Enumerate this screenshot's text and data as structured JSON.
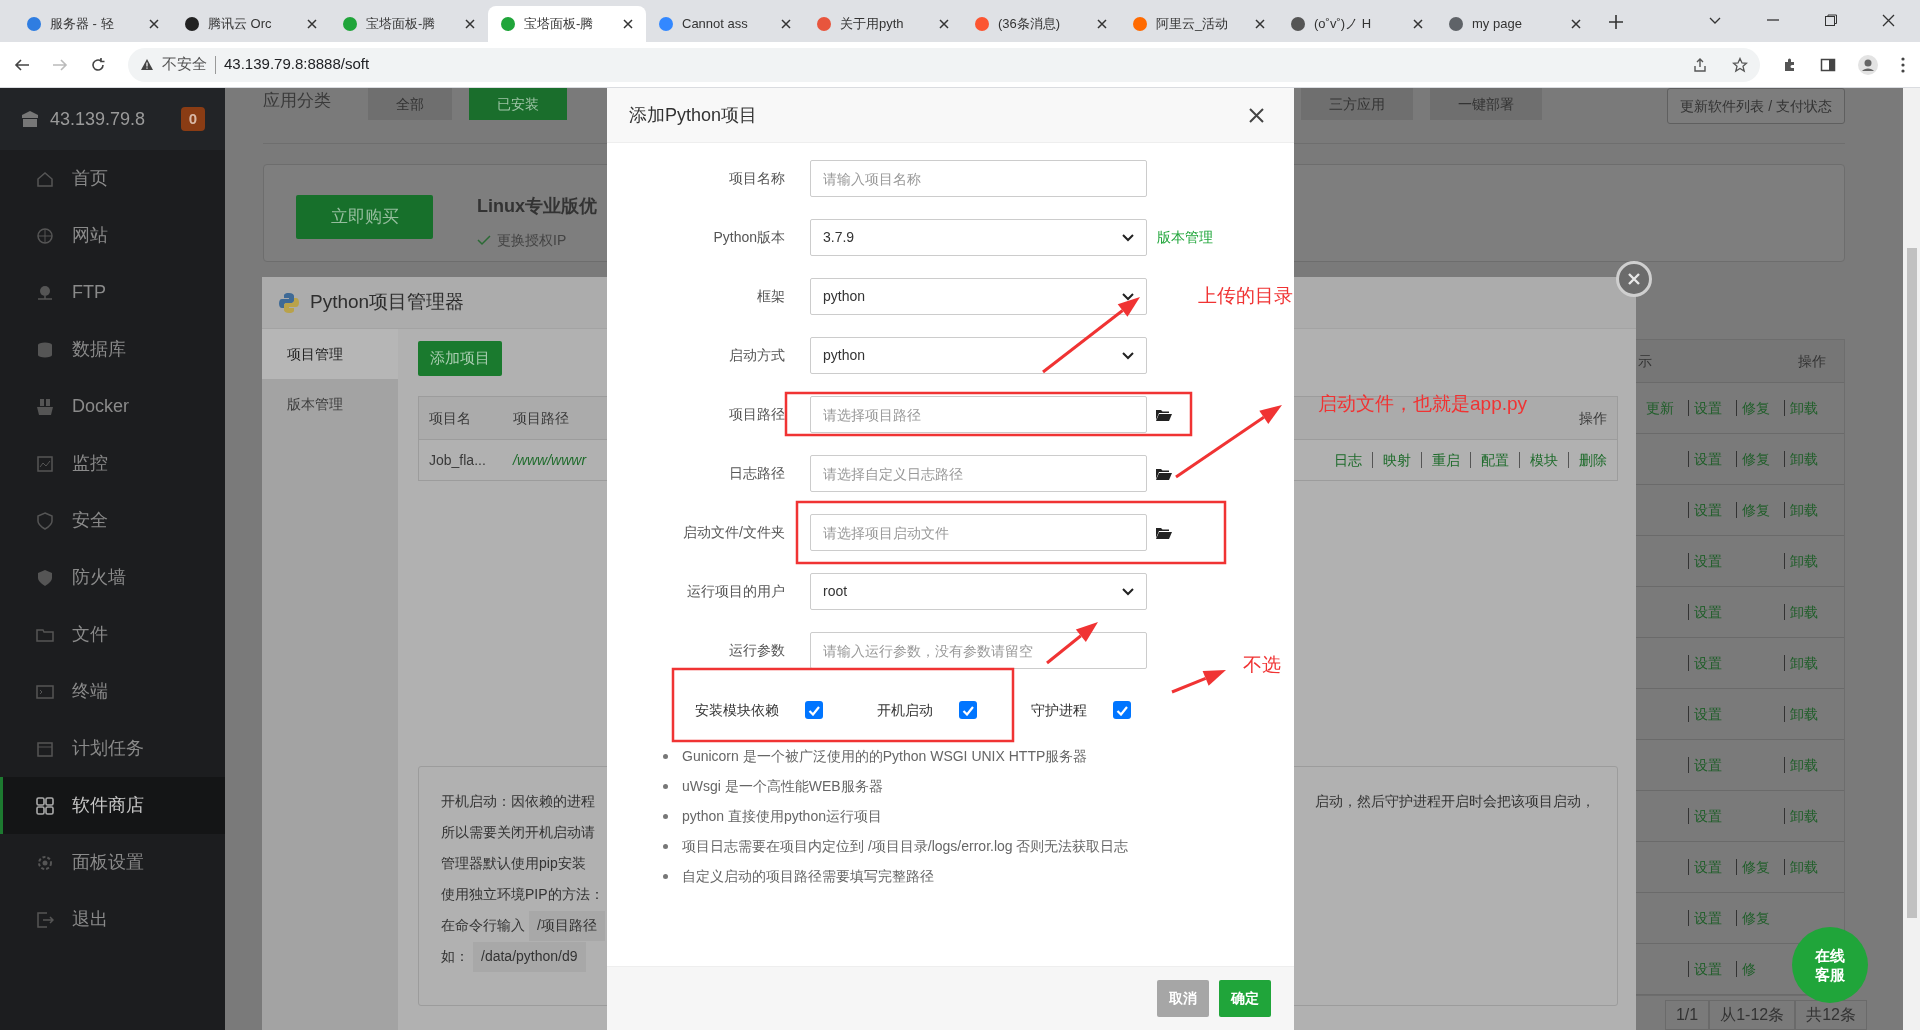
{
  "browser": {
    "tabs": [
      {
        "title": "服务器 - 轻",
        "selected": false,
        "color": "#2f7de1"
      },
      {
        "title": "腾讯云 Orc",
        "selected": false,
        "color": "#222222"
      },
      {
        "title": "宝塔面板-腾",
        "selected": false,
        "color": "#20a53a"
      },
      {
        "title": "宝塔面板-腾",
        "selected": true,
        "color": "#20a53a"
      },
      {
        "title": "Cannot ass",
        "selected": false,
        "color": "#3388ff"
      },
      {
        "title": "关于用pyth",
        "selected": false,
        "color": "#e8553d"
      },
      {
        "title": "(36条消息)",
        "selected": false,
        "color": "#fc5531"
      },
      {
        "title": "阿里云_活动",
        "selected": false,
        "color": "#ff6a00"
      },
      {
        "title": "(o˚v˚)ノ H",
        "selected": false,
        "color": "#555555"
      },
      {
        "title": "my page",
        "selected": false,
        "color": "#5f6368"
      }
    ],
    "address": {
      "security": "不安全",
      "url": "43.139.79.8:8888/soft"
    }
  },
  "sidebar": {
    "host": "43.139.79.8",
    "badge": "0",
    "items": [
      {
        "label": "首页",
        "selected": false
      },
      {
        "label": "网站",
        "selected": false
      },
      {
        "label": "FTP",
        "selected": false
      },
      {
        "label": "数据库",
        "selected": false
      },
      {
        "label": "Docker",
        "selected": false
      },
      {
        "label": "监控",
        "selected": false
      },
      {
        "label": "安全",
        "selected": false
      },
      {
        "label": "防火墙",
        "selected": false
      },
      {
        "label": "文件",
        "selected": false
      },
      {
        "label": "终端",
        "selected": false
      },
      {
        "label": "计划任务",
        "selected": false
      },
      {
        "label": "软件商店",
        "selected": true
      },
      {
        "label": "面板设置",
        "selected": false
      },
      {
        "label": "退出",
        "selected": false
      }
    ]
  },
  "store": {
    "category_label": "应用分类",
    "filters": [
      {
        "label": "全部",
        "selected": false
      },
      {
        "label": "已安装",
        "selected": true
      }
    ],
    "filters_right": [
      {
        "label": "三方应用",
        "selected": false
      },
      {
        "label": "一键部署",
        "selected": false
      }
    ],
    "refresh_button": "更新软件列表 / 支付状态",
    "banner": {
      "buy_button": "立即购买",
      "title": "Linux专业版优",
      "feature": "更换授权IP"
    },
    "table": {
      "column_1": "示",
      "column_2": "操作",
      "rows": [
        {
          "actions": [
            {
              "label": "更新",
              "kind": "update"
            },
            {
              "label": "设置",
              "kind": "settings"
            },
            {
              "label": "修复",
              "kind": "repair"
            },
            {
              "label": "卸载",
              "kind": "uninstall"
            }
          ]
        },
        {
          "actions": [
            {
              "label": "设置",
              "kind": "settings"
            },
            {
              "label": "修复",
              "kind": "repair"
            },
            {
              "label": "卸载",
              "kind": "uninstall"
            }
          ]
        },
        {
          "actions": [
            {
              "label": "设置",
              "kind": "settings"
            },
            {
              "label": "修复",
              "kind": "repair"
            },
            {
              "label": "卸载",
              "kind": "uninstall"
            }
          ]
        },
        {
          "actions": [
            {
              "label": "设置",
              "kind": "settings"
            },
            {
              "label": "卸载",
              "kind": "uninstall"
            }
          ]
        },
        {
          "actions": [
            {
              "label": "设置",
              "kind": "settings"
            },
            {
              "label": "卸载",
              "kind": "uninstall"
            }
          ]
        },
        {
          "actions": [
            {
              "label": "设置",
              "kind": "settings"
            },
            {
              "label": "卸载",
              "kind": "uninstall"
            }
          ]
        },
        {
          "actions": [
            {
              "label": "设置",
              "kind": "settings"
            },
            {
              "label": "卸载",
              "kind": "uninstall"
            }
          ]
        },
        {
          "actions": [
            {
              "label": "设置",
              "kind": "settings"
            },
            {
              "label": "卸载",
              "kind": "uninstall"
            }
          ]
        },
        {
          "actions": [
            {
              "label": "设置",
              "kind": "settings"
            },
            {
              "label": "卸载",
              "kind": "uninstall"
            }
          ]
        },
        {
          "actions": [
            {
              "label": "设置",
              "kind": "settings"
            },
            {
              "label": "修复",
              "kind": "repair"
            },
            {
              "label": "卸载",
              "kind": "uninstall"
            }
          ]
        },
        {
          "actions": [
            {
              "label": "设置",
              "kind": "settings"
            },
            {
              "label": "修复",
              "kind": "repair"
            }
          ]
        },
        {
          "actions": [
            {
              "label": "设置",
              "kind": "settings"
            },
            {
              "label": "修",
              "kind": "repair"
            }
          ]
        }
      ]
    },
    "pagination": [
      "1/1",
      "从1-12条",
      "共12条"
    ]
  },
  "python_manager": {
    "title": "Python项目管理器",
    "nav": [
      {
        "label": "项目管理",
        "selected": true
      },
      {
        "label": "版本管理",
        "selected": false
      }
    ],
    "add_button": "添加项目",
    "table": {
      "columns": [
        "项目名",
        "项目路径"
      ],
      "actions_column": "操作",
      "rows": [
        {
          "name": "Job_fla...",
          "path": "/www/wwwr",
          "actions": [
            "日志",
            "映射",
            "重启",
            "配置",
            "模块",
            "删除"
          ]
        }
      ]
    },
    "info": [
      {
        "left": "开机启动：因依赖的进程",
        "right": "启动，然后守护进程开启时会把该项目启动，"
      },
      {
        "left": "所以需要关闭开机启动请"
      },
      {
        "left": "管理器默认使用pip安装"
      },
      {
        "left": "使用独立环境PIP的方法："
      },
      {
        "left": "在命令行输入",
        "code": "/项目路径"
      },
      {
        "left": "如：",
        "code": "/data/python/d9"
      }
    ]
  },
  "dialog": {
    "title": "添加Python项目",
    "fields": [
      {
        "kind": "text",
        "label": "项目名称",
        "placeholder": "请输入项目名称"
      },
      {
        "kind": "select",
        "label": "Python版本",
        "value": "3.7.9",
        "link": "版本管理"
      },
      {
        "kind": "select",
        "label": "框架",
        "value": "python"
      },
      {
        "kind": "select",
        "label": "启动方式",
        "value": "python"
      },
      {
        "kind": "path",
        "label": "项目路径",
        "placeholder": "请选择项目路径"
      },
      {
        "kind": "path",
        "label": "日志路径",
        "placeholder": "请选择自定义日志路径"
      },
      {
        "kind": "path",
        "label": "启动文件/文件夹",
        "placeholder": "请选择项目启动文件"
      },
      {
        "kind": "select",
        "label": "运行项目的用户",
        "value": "root"
      },
      {
        "kind": "text",
        "label": "运行参数",
        "placeholder": "请输入运行参数，没有参数请留空"
      }
    ],
    "options": [
      {
        "label": "安装模块依赖",
        "checked": true
      },
      {
        "label": "开机启动",
        "checked": true
      },
      {
        "label": "守护进程",
        "checked": true
      }
    ],
    "notes": [
      "Gunicorn 是一个被广泛使用的的Python WSGI UNIX HTTP服务器",
      "uWsgi 是一个高性能WEB服务器",
      "python 直接使用python运行项目",
      "项目日志需要在项目内定位到 /项目目录/logs/error.log 否则无法获取日志",
      "自定义启动的项目路径需要填写完整路径"
    ],
    "buttons": [
      {
        "label": "取消",
        "disabled": true
      },
      {
        "label": "确定",
        "disabled": false
      }
    ]
  },
  "annotations": [
    "上传的目录",
    "启动文件，也就是app.py",
    "不选"
  ],
  "chat_button": "在线客服"
}
